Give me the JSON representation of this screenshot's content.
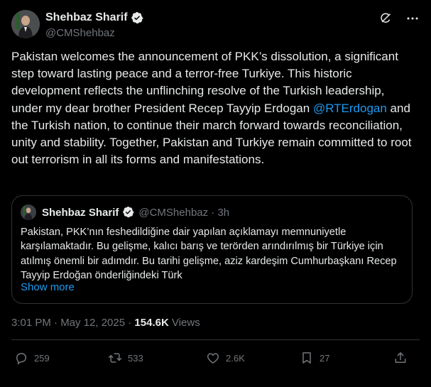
{
  "author": {
    "display_name": "Shehbaz Sharif",
    "handle": "@CMShehbaz"
  },
  "header_icons": [
    "grok-icon",
    "more-icon"
  ],
  "post": {
    "text_before_mention": "Pakistan welcomes the announcement of PKK’s dissolution, a significant step toward lasting peace and a terror-free Turkiye. This historic development reflects the unflinching resolve of the Turkish leadership, under my dear brother President Recep Tayyip Erdogan ",
    "mention": "@RTErdogan",
    "text_after_mention": " and the Turkish nation, to continue their march forward towards reconciliation, unity and stability. Together, Pakistan and Turkiye remain committed to root out terrorism in all its forms and manifestations."
  },
  "quote": {
    "display_name": "Shehbaz Sharif",
    "handle_time": "@CMShehbaz · 3h",
    "text": "Pakistan, PKK’nın feshedildiğine dair yapılan açıklamayı memnuniyetle karşılamaktadır. Bu gelişme, kalıcı barış ve terörden arındırılmış bir Türkiye için atılmış önemli bir adımdır. Bu tarihi gelişme, aziz kardeşim Cumhurbaşkanı Recep Tayyip Erdoğan önderliğindeki Türk",
    "show_more": "Show more"
  },
  "meta": {
    "timestamp": "3:01 PM · May 12, 2025 · ",
    "views_count": "154.6K",
    "views_label": " Views"
  },
  "actions": {
    "replies": "259",
    "reposts": "533",
    "likes": "2.6K",
    "bookmarks": "27"
  },
  "colors": {
    "background": "#000000",
    "text": "#e7e9ea",
    "muted": "#71767b",
    "accent": "#1d9bf0",
    "border": "#2f3336"
  }
}
